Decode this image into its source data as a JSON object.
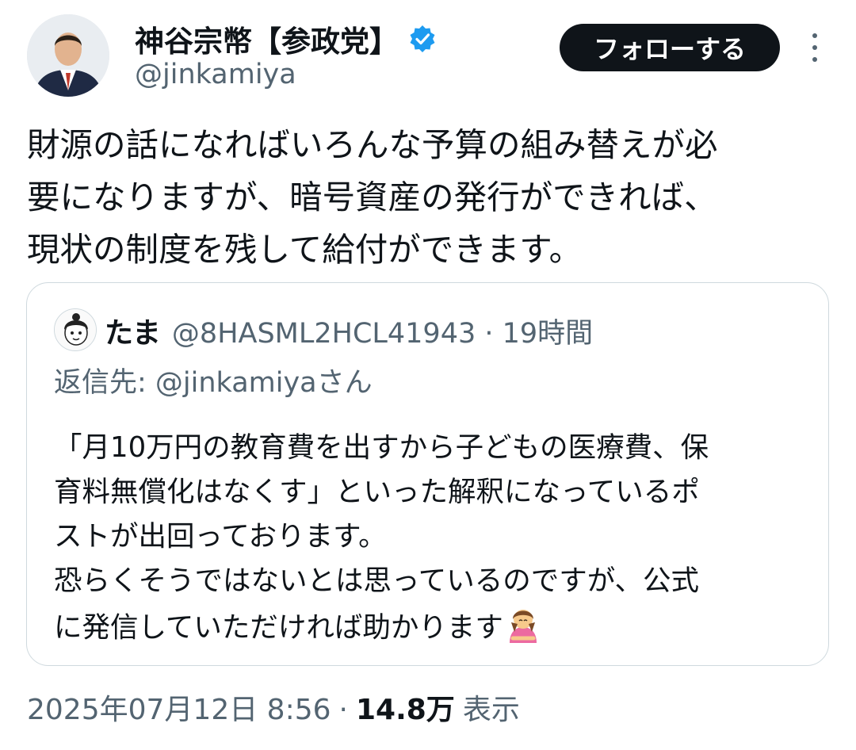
{
  "author": {
    "display_name": "神谷宗幣【参政党】",
    "handle": "@jinkamiya"
  },
  "actions": {
    "follow_label": "フォローする"
  },
  "tweet": {
    "lines": [
      "財源の話になればいろんな予算の組み替えが必",
      "要になりますが、暗号資産の発行ができれば、",
      "現状の制度を残して給付ができます。"
    ]
  },
  "quote": {
    "name": "たま",
    "handle_time": "@8HASML2HCL41943 · 19時間",
    "reply_to": "返信先: @jinkamiyaさん",
    "lines": [
      "「月10万円の教育費を出すから子どもの医療費、保",
      "育料無償化はなくす」といった解釈になっているポ",
      "ストが出回っております。",
      "恐らくそうではないとは思っているのですが、公式",
      "に発信していただければ助かります"
    ],
    "emoji_icon": "person-bowing-emoji"
  },
  "footer": {
    "datetime": "2025年07月12日 8:56",
    "separator": "·",
    "views": "14.8万",
    "views_label": "表示"
  },
  "colors": {
    "text": "#0f1419",
    "secondary": "#536471",
    "verified": "#1d9bf0",
    "border": "#cfd9de"
  }
}
